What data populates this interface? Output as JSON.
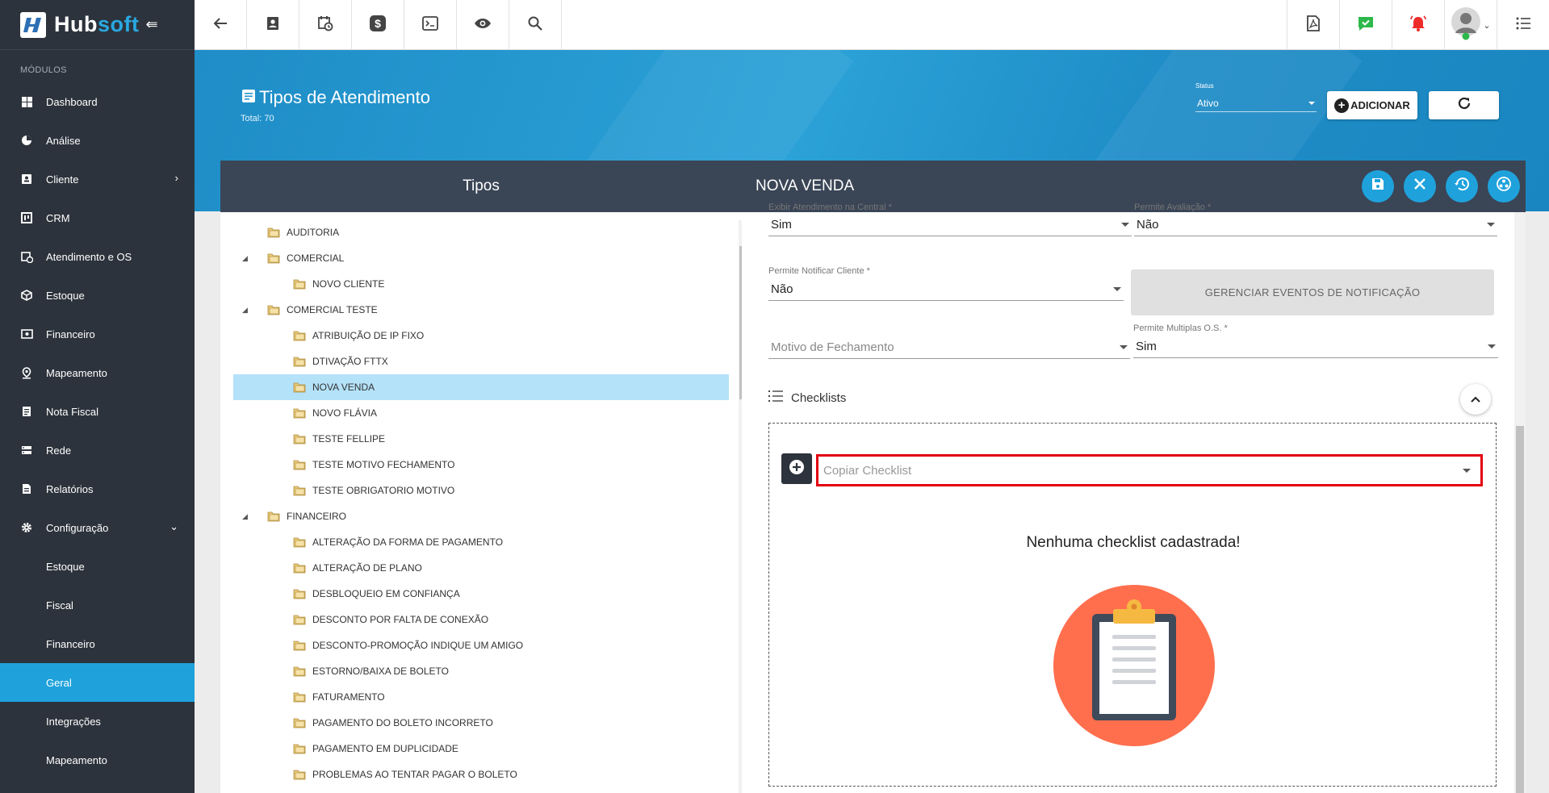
{
  "app": {
    "brand_part1": "Hub",
    "brand_part2": "soft"
  },
  "sidebar": {
    "section_label": "MÓDULOS",
    "items": [
      {
        "label": "Dashboard",
        "icon": "grid-icon"
      },
      {
        "label": "Análise",
        "icon": "pie-chart-icon"
      },
      {
        "label": "Cliente",
        "icon": "contact-card-icon",
        "has_arrow": "right"
      },
      {
        "label": "CRM",
        "icon": "kanban-icon"
      },
      {
        "label": "Atendimento e OS",
        "icon": "calendar-clock-icon"
      },
      {
        "label": "Estoque",
        "icon": "box-icon"
      },
      {
        "label": "Financeiro",
        "icon": "money-icon"
      },
      {
        "label": "Mapeamento",
        "icon": "map-pin-icon"
      },
      {
        "label": "Nota Fiscal",
        "icon": "document-icon"
      },
      {
        "label": "Rede",
        "icon": "server-icon"
      },
      {
        "label": "Relatórios",
        "icon": "report-icon"
      },
      {
        "label": "Configuração",
        "icon": "gear-icon",
        "has_arrow": "down"
      }
    ],
    "sub_items": [
      {
        "label": "Estoque"
      },
      {
        "label": "Fiscal"
      },
      {
        "label": "Financeiro"
      },
      {
        "label": "Geral",
        "active": true
      },
      {
        "label": "Integrações"
      },
      {
        "label": "Mapeamento"
      }
    ]
  },
  "topbar": {
    "left_icons": [
      "back-arrow-icon",
      "contact-icon",
      "calendar-clock-icon",
      "dollar-icon",
      "terminal-icon",
      "eye-icon",
      "search-icon"
    ],
    "right_icons": [
      "pdf-icon",
      "chat-check-icon",
      "alarm-bell-icon",
      "avatar",
      "menu-list-icon"
    ]
  },
  "header": {
    "title": "Tipos de Atendimento",
    "total": "Total: 70",
    "status_label": "Status",
    "status_value": "Ativo",
    "add_label": "ADICIONAR"
  },
  "left_panel": {
    "title": "Tipos",
    "tree": [
      {
        "label": "AUDITORIA",
        "level": 0
      },
      {
        "label": "COMERCIAL",
        "level": 0,
        "expanded": true
      },
      {
        "label": "NOVO CLIENTE",
        "level": 1
      },
      {
        "label": "COMERCIAL TESTE",
        "level": 0,
        "expanded": true
      },
      {
        "label": "ATRIBUIÇÃO DE IP FIXO",
        "level": 1
      },
      {
        "label": "DTIVAÇÃO FTTX",
        "level": 1
      },
      {
        "label": "NOVA VENDA",
        "level": 1,
        "selected": true
      },
      {
        "label": "NOVO FLÁVIA",
        "level": 1
      },
      {
        "label": "TESTE FELLIPE",
        "level": 1
      },
      {
        "label": "TESTE MOTIVO FECHAMENTO",
        "level": 1
      },
      {
        "label": "TESTE OBRIGATORIO MOTIVO",
        "level": 1
      },
      {
        "label": "FINANCEIRO",
        "level": 0,
        "expanded": true
      },
      {
        "label": "ALTERAÇÃO DA FORMA DE PAGAMENTO",
        "level": 1
      },
      {
        "label": "ALTERAÇÃO DE PLANO",
        "level": 1
      },
      {
        "label": "DESBLOQUEIO EM CONFIANÇA",
        "level": 1
      },
      {
        "label": "DESCONTO POR FALTA DE CONEXÃO",
        "level": 1
      },
      {
        "label": "DESCONTO-PROMOÇÃO INDIQUE UM AMIGO",
        "level": 1
      },
      {
        "label": "ESTORNO/BAIXA DE BOLETO",
        "level": 1
      },
      {
        "label": "FATURAMENTO",
        "level": 1
      },
      {
        "label": "PAGAMENTO DO BOLETO INCORRETO",
        "level": 1
      },
      {
        "label": "PAGAMENTO EM DUPLICIDADE",
        "level": 1
      },
      {
        "label": "PROBLEMAS AO TENTAR PAGAR O BOLETO",
        "level": 1
      }
    ]
  },
  "right_panel": {
    "title": "NOVA VENDA",
    "fields": {
      "exibir_label": "Exibir Atendimento na Central *",
      "exibir_value": "Sim",
      "avaliacao_label": "Permite Avaliação *",
      "avaliacao_value": "Não",
      "notificar_label": "Permite Notificar Cliente *",
      "notificar_value": "Não",
      "gerenciar_label": "GERENCIAR EVENTOS DE NOTIFICAÇÃO",
      "motivo_placeholder": "Motivo de Fechamento",
      "multiplas_label": "Permite Multiplas O.S. *",
      "multiplas_value": "Sim"
    },
    "checklists": {
      "title": "Checklists",
      "copy_placeholder": "Copiar Checklist",
      "empty_text": "Nenhuma checklist cadastrada!"
    }
  },
  "colors": {
    "sidebar_bg": "#2d333c",
    "accent": "#1fa2dc",
    "panel_head": "#3a4556",
    "highlight_border": "#e3000f",
    "illustration_circle": "#ff6f4e"
  }
}
